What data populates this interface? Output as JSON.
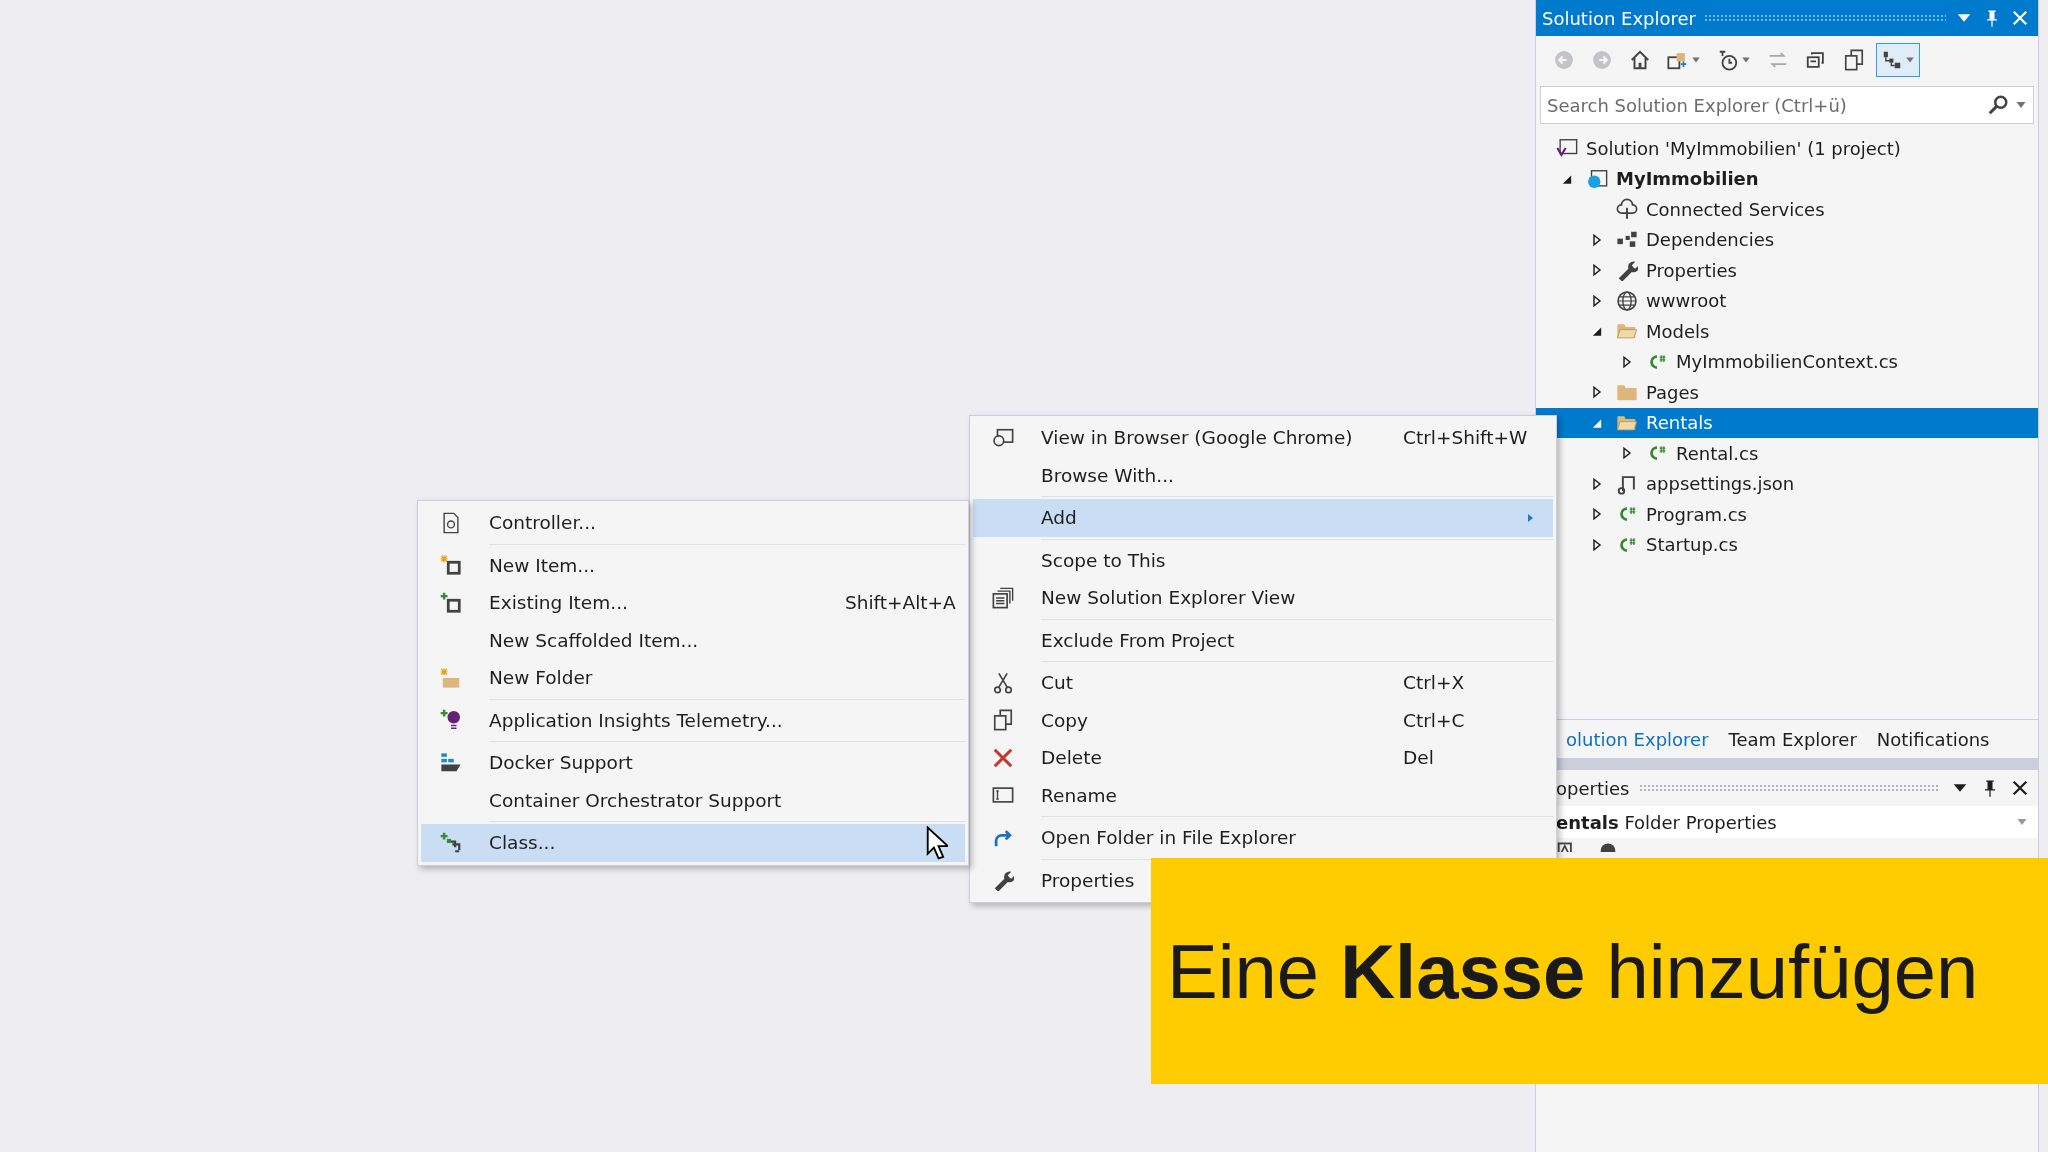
{
  "solution_explorer": {
    "title": "Solution Explorer",
    "toolbar": [
      {
        "kind": "back",
        "pressed": false
      },
      {
        "kind": "forward",
        "pressed": false
      },
      {
        "kind": "home",
        "pressed": false
      },
      {
        "kind": "sync",
        "pressed": false
      },
      {
        "kind": "history",
        "pressed": false
      },
      {
        "kind": "switch",
        "pressed": false
      },
      {
        "kind": "collapse",
        "pressed": false
      },
      {
        "kind": "copy",
        "pressed": false
      },
      {
        "kind": "tree",
        "pressed": true
      }
    ],
    "search": {
      "placeholder": "Search Solution Explorer (Ctrl+ü)"
    },
    "tree": [
      {
        "label": "Solution 'MyImmobilien' (1 project)",
        "kind": "solution",
        "selected": false,
        "children": [
          {
            "label": "MyImmobilien",
            "kind": "project",
            "expanded": true,
            "selected": false,
            "children": [
              {
                "label": "Connected Services",
                "kind": "cloud",
                "selected": false
              },
              {
                "label": "Dependencies",
                "kind": "dependencies",
                "expanded": false,
                "selected": false
              },
              {
                "label": "Properties",
                "kind": "wrench",
                "expanded": false,
                "selected": false
              },
              {
                "label": "wwwroot",
                "kind": "globe",
                "expanded": false,
                "selected": false
              },
              {
                "label": "Models",
                "kind": "folder-open",
                "expanded": true,
                "selected": false,
                "children": [
                  {
                    "label": "MyImmobilienContext.cs",
                    "kind": "csharp",
                    "expanded": false,
                    "selected": false
                  }
                ]
              },
              {
                "label": "Pages",
                "kind": "folder",
                "expanded": false,
                "selected": false
              },
              {
                "label": "Rentals",
                "kind": "folder-open",
                "expanded": true,
                "selected": true,
                "children": [
                  {
                    "label": "Rental.cs",
                    "kind": "csharp",
                    "expanded": false,
                    "selected": false
                  }
                ]
              },
              {
                "label": "appsettings.json",
                "kind": "json",
                "expanded": false,
                "selected": false
              },
              {
                "label": "Program.cs",
                "kind": "csharp",
                "expanded": false,
                "selected": false
              },
              {
                "label": "Startup.cs",
                "kind": "csharp",
                "expanded": false,
                "selected": false
              }
            ]
          }
        ]
      }
    ],
    "tabs": [
      {
        "label": "olution Explorer",
        "selected": true
      },
      {
        "label": "Team Explorer",
        "selected": false
      },
      {
        "label": "Notifications",
        "selected": false
      }
    ],
    "properties": {
      "title": "operties",
      "object": "**entals** Folder Properties"
    }
  },
  "context_menu": {
    "groups": [
      [
        {
          "label": "View in Browser (Google Chrome)",
          "shortcut": "Ctrl+Shift+W",
          "kind": "browser",
          "selected": false,
          "submenu": false
        },
        {
          "label": "Browse With...",
          "kind": "plain",
          "selected": false,
          "submenu": false
        }
      ],
      [
        {
          "label": "Add",
          "kind": "plain",
          "selected": true,
          "submenu": true
        }
      ],
      [
        {
          "label": "Scope to This",
          "kind": "plain",
          "selected": false,
          "submenu": false
        },
        {
          "label": "New Solution Explorer View",
          "kind": "windows",
          "selected": false,
          "submenu": false
        }
      ],
      [
        {
          "label": "Exclude From Project",
          "kind": "plain",
          "selected": false,
          "submenu": false
        }
      ],
      [
        {
          "label": "Cut",
          "shortcut": "Ctrl+X",
          "kind": "scissors",
          "selected": false,
          "submenu": false
        },
        {
          "label": "Copy",
          "shortcut": "Ctrl+C",
          "kind": "copy",
          "selected": false,
          "submenu": false
        },
        {
          "label": "Delete",
          "shortcut": "Del",
          "kind": "delete",
          "selected": false,
          "submenu": false
        },
        {
          "label": "Rename",
          "kind": "rename",
          "selected": false,
          "submenu": false
        }
      ],
      [
        {
          "label": "Open Folder in File Explorer",
          "kind": "redo",
          "selected": false,
          "submenu": false
        }
      ],
      [
        {
          "label": "Properties",
          "kind": "wrench",
          "selected": false,
          "submenu": false
        }
      ]
    ]
  },
  "add_submenu": {
    "groups": [
      [
        {
          "label": "Controller...",
          "kind": "controller",
          "selected": false
        }
      ],
      [
        {
          "label": "New Item...",
          "kind": "new-item",
          "selected": false
        },
        {
          "label": "Existing Item...",
          "shortcut": "Shift+Alt+A",
          "kind": "existing-item",
          "selected": false
        },
        {
          "label": "New Scaffolded Item...",
          "kind": "plain",
          "selected": false
        },
        {
          "label": "New Folder",
          "kind": "new-folder",
          "selected": false
        }
      ],
      [
        {
          "label": "Application Insights Telemetry...",
          "kind": "bulb",
          "selected": false
        }
      ],
      [
        {
          "label": "Docker Support",
          "kind": "docker",
          "selected": false
        },
        {
          "label": "Container Orchestrator Support",
          "kind": "plain",
          "selected": false
        }
      ],
      [
        {
          "label": "Class...",
          "kind": "class",
          "selected": true
        }
      ]
    ]
  },
  "caption": {
    "text": "Eine **Klasse** hinzufügen"
  }
}
